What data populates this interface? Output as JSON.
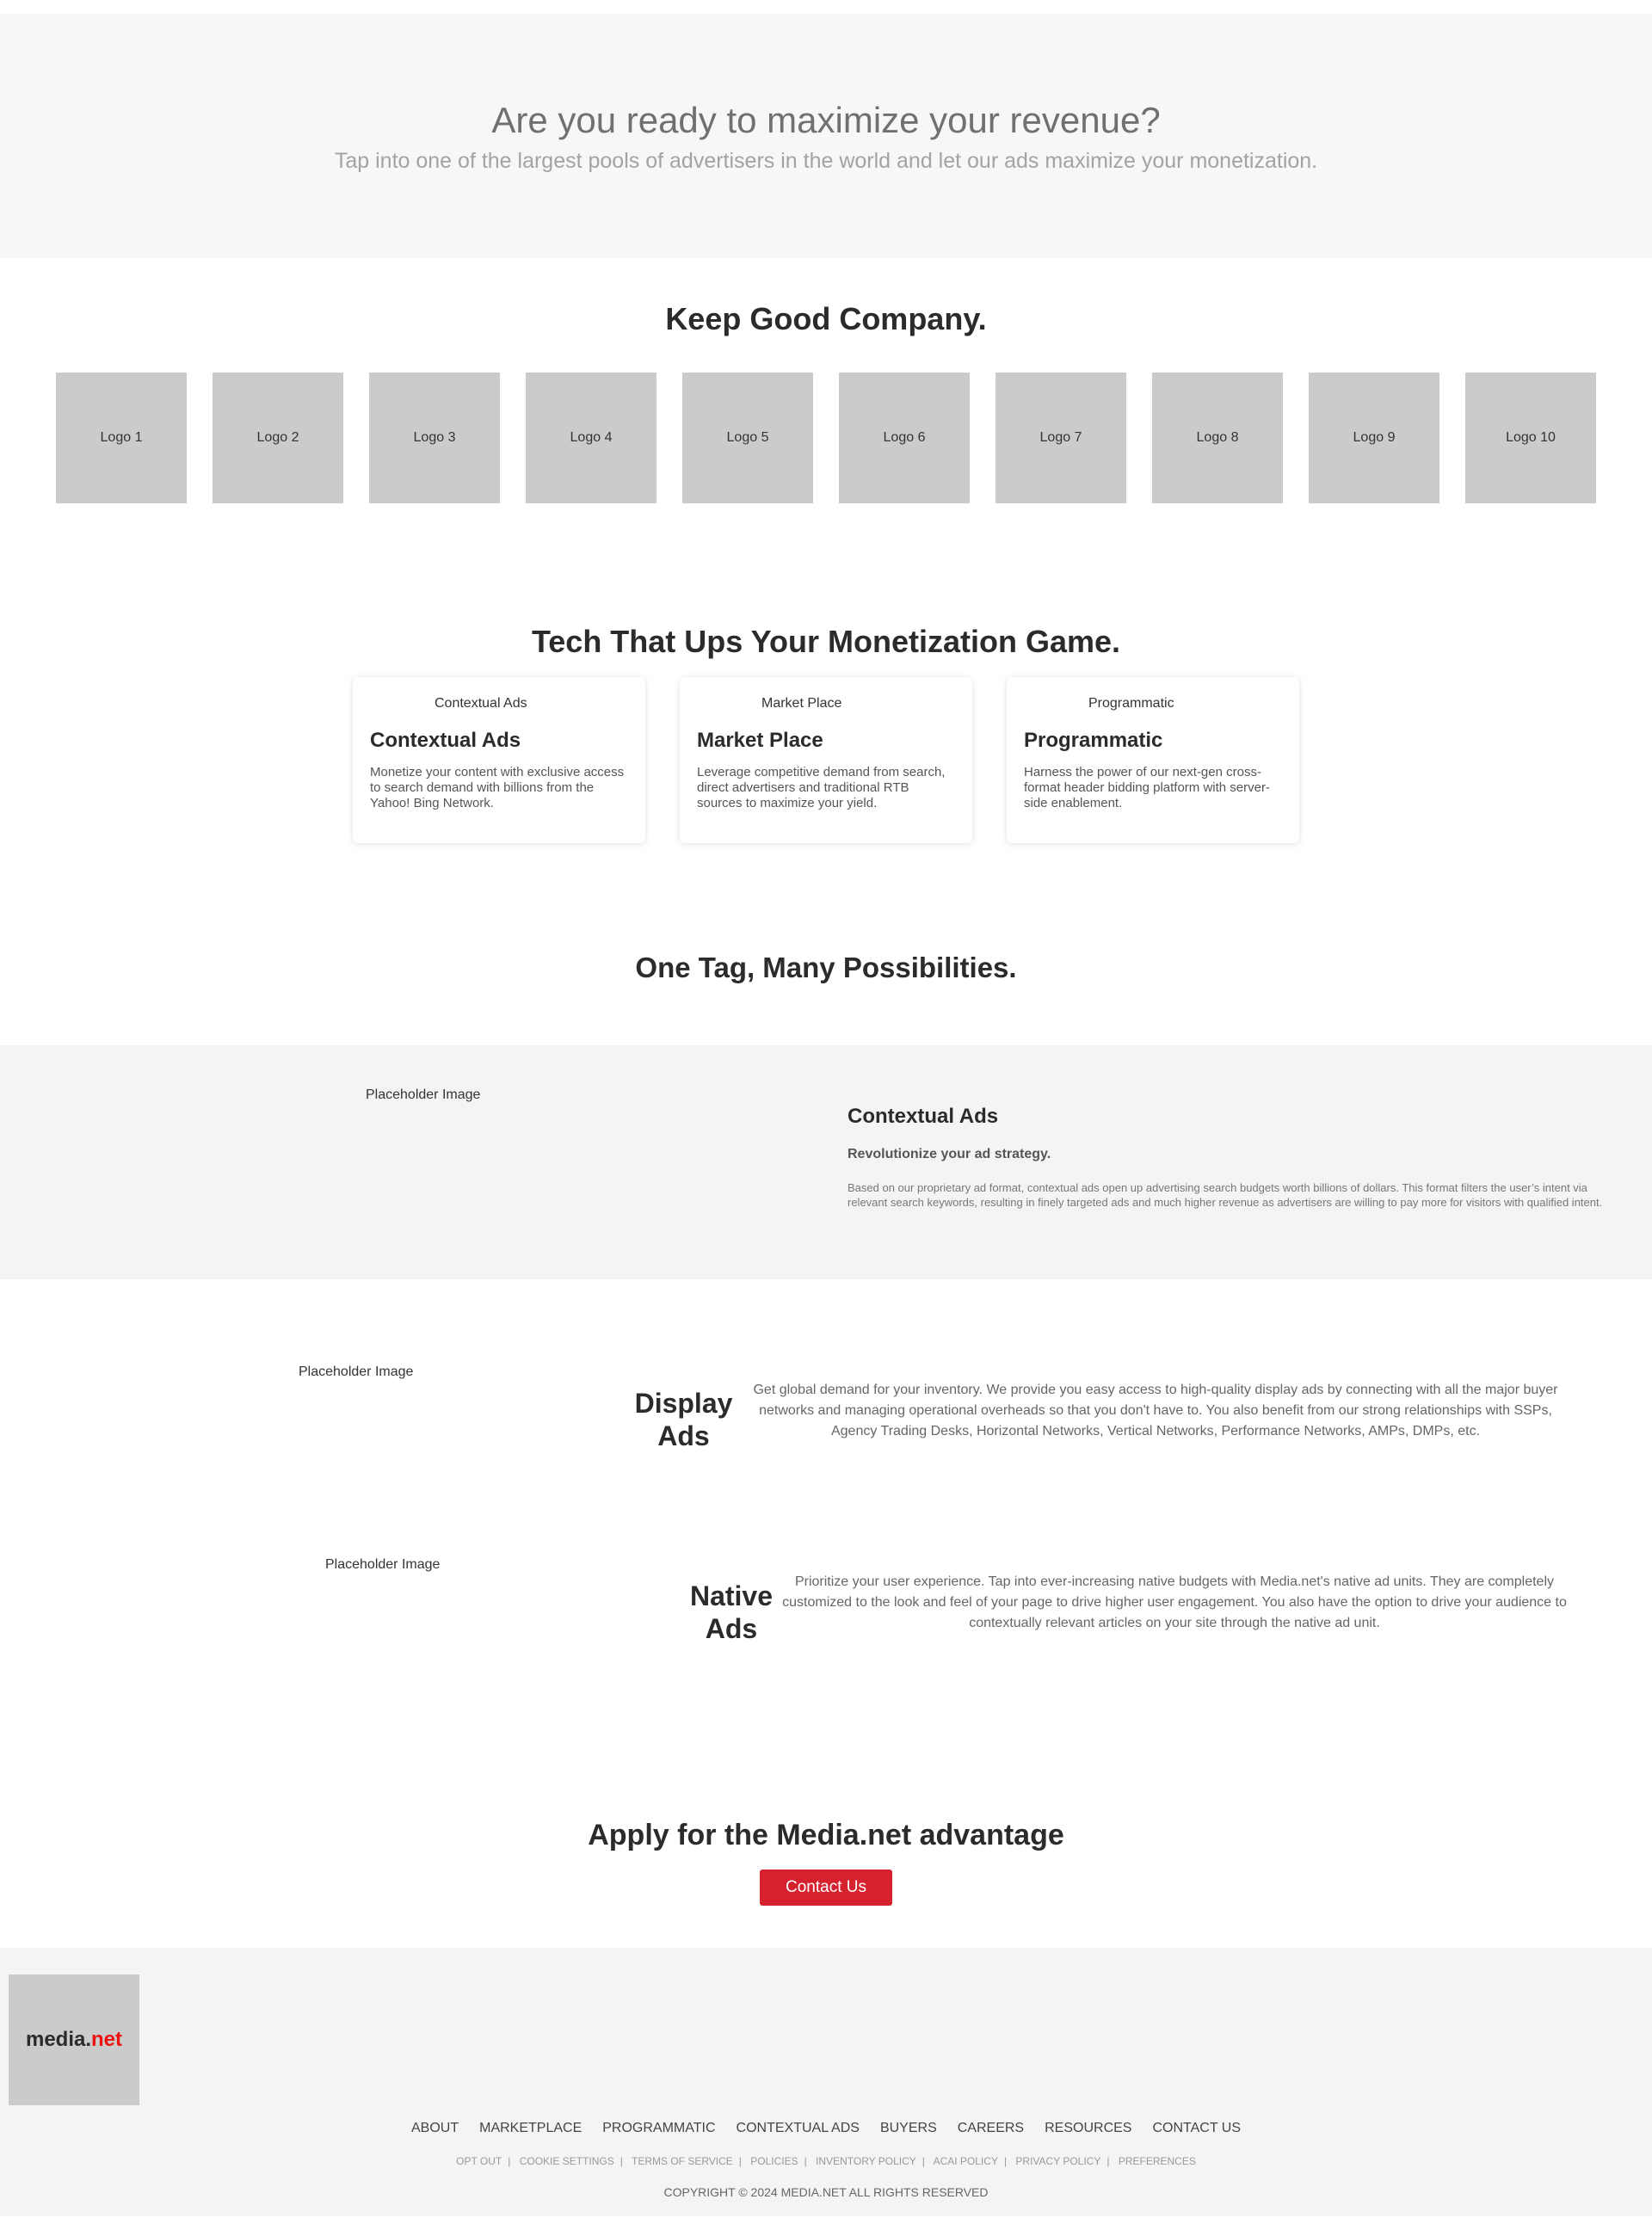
{
  "hero": {
    "title": "Are you ready to maximize your revenue?",
    "subtitle": "Tap into one of the largest pools of advertisers in the world and let our ads maximize your monetization."
  },
  "company": {
    "heading": "Keep Good Company.",
    "logos": [
      "Logo 1",
      "Logo 2",
      "Logo 3",
      "Logo 4",
      "Logo 5",
      "Logo 6",
      "Logo 7",
      "Logo 8",
      "Logo 9",
      "Logo 10"
    ]
  },
  "tech": {
    "heading": "Tech That Ups Your Monetization Game.",
    "cards": [
      {
        "image_label": "Contextual Ads",
        "title": "Contextual Ads",
        "desc": "Monetize your content with exclusive access to search demand with billions from the Yahoo! Bing Network."
      },
      {
        "image_label": "Market Place",
        "title": "Market Place",
        "desc": "Leverage competitive demand from search, direct advertisers and traditional RTB sources to maximize your yield."
      },
      {
        "image_label": "Programmatic",
        "title": "Programmatic",
        "desc": "Harness the power of our next-gen cross-format header bidding platform with server-side enablement."
      }
    ]
  },
  "one_tag": {
    "heading": "One Tag, Many Possibilities."
  },
  "contextual": {
    "image_label": "Placeholder Image",
    "title": "Contextual Ads",
    "subtitle": "Revolutionize your ad strategy.",
    "desc": "Based on our proprietary ad format, contextual ads open up advertising search budgets worth billions of dollars. This format filters the user’s intent via relevant search keywords, resulting in finely targeted ads and much higher revenue as advertisers are willing to pay more for visitors with qualified intent."
  },
  "display": {
    "image_label": "Placeholder Image",
    "title": "Display Ads",
    "desc": "Get global demand for your inventory. We provide you easy access to high-quality display ads by connecting with all the major buyer networks and managing operational overheads so that you don't have to. You also benefit from our strong relationships with SSPs, Agency Trading Desks, Horizontal Networks, Vertical Networks, Performance Networks, AMPs, DMPs, etc."
  },
  "native": {
    "image_label": "Placeholder Image",
    "title": "Native Ads",
    "desc": "Prioritize your user experience. Tap into ever-increasing native budgets with Media.net's native ad units. They are completely customized to the look and feel of your page to drive higher user engagement. You also have the option to drive your audience to contextually relevant articles on your site through the native ad unit."
  },
  "apply": {
    "heading": "Apply for the Media.net advantage",
    "button": "Contact Us"
  },
  "footer": {
    "logo_main": "media.",
    "logo_accent": "net",
    "nav": [
      "ABOUT",
      "MARKETPLACE",
      "PROGRAMMATIC",
      "CONTEXTUAL ADS",
      "BUYERS",
      "CAREERS",
      "RESOURCES",
      "CONTACT US"
    ],
    "links": [
      "OPT OUT",
      "COOKIE SETTINGS",
      "TERMS OF SERVICE",
      "POLICIES",
      "INVENTORY POLICY",
      "ACAI POLICY",
      "PRIVACY POLICY",
      "PREFERENCES"
    ],
    "copyright": "COPYRIGHT © 2024 MEDIA.NET ALL RIGHTS RESERVED"
  }
}
